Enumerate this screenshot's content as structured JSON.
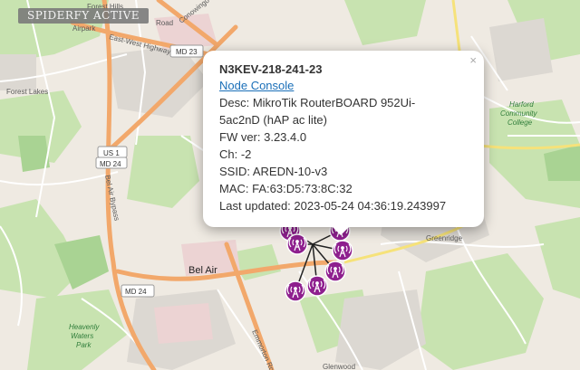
{
  "banner": "SPIDERFY ACTIVE",
  "popup": {
    "title": "N3KEV-218-241-23",
    "link": "Node Console",
    "desc_line1": "Desc: MikroTik RouterBOARD 952Ui-",
    "desc_line2": "5ac2nD (hAP ac lite)",
    "fw": "FW ver: 3.23.4.0",
    "ch": "Ch: -2",
    "ssid": "SSID: AREDN-10-v3",
    "mac": "MAC: FA:63:D5:73:8C:32",
    "updated": "Last updated: 2023-05-24 04:36:19.243997",
    "close": "×"
  },
  "map_labels": {
    "forest_hills": "Forest Hills",
    "airpark": "Airpark",
    "east_west_highway": "East-West Highway",
    "md23": "MD 23",
    "forest_lakes": "Forest Lakes",
    "us1": "US 1",
    "md24_top": "MD 24",
    "bel_air_bypass": "Bel Air Bypass",
    "bel_air": "Bel Air",
    "md24_bottom": "MD 24",
    "heavenly_waters_1": "Heavenly",
    "heavenly_waters_2": "Waters",
    "heavenly_waters_3": "Park",
    "harford_1": "Harford",
    "harford_2": "Community",
    "harford_3": "College",
    "greenridge": "Greenridge",
    "emmorton_road": "Emmorton Road",
    "glenwood": "Glenwood",
    "conowingo": "Conowingo Rd",
    "road": "Road"
  },
  "colors": {
    "marker": "#8e1f8e",
    "major_road": "#f2a86b",
    "park": "#bfe0a8"
  },
  "markers": [
    {
      "name": "marker-1"
    },
    {
      "name": "marker-2"
    },
    {
      "name": "marker-3"
    },
    {
      "name": "marker-4"
    },
    {
      "name": "marker-5"
    },
    {
      "name": "marker-6"
    },
    {
      "name": "marker-7"
    }
  ]
}
